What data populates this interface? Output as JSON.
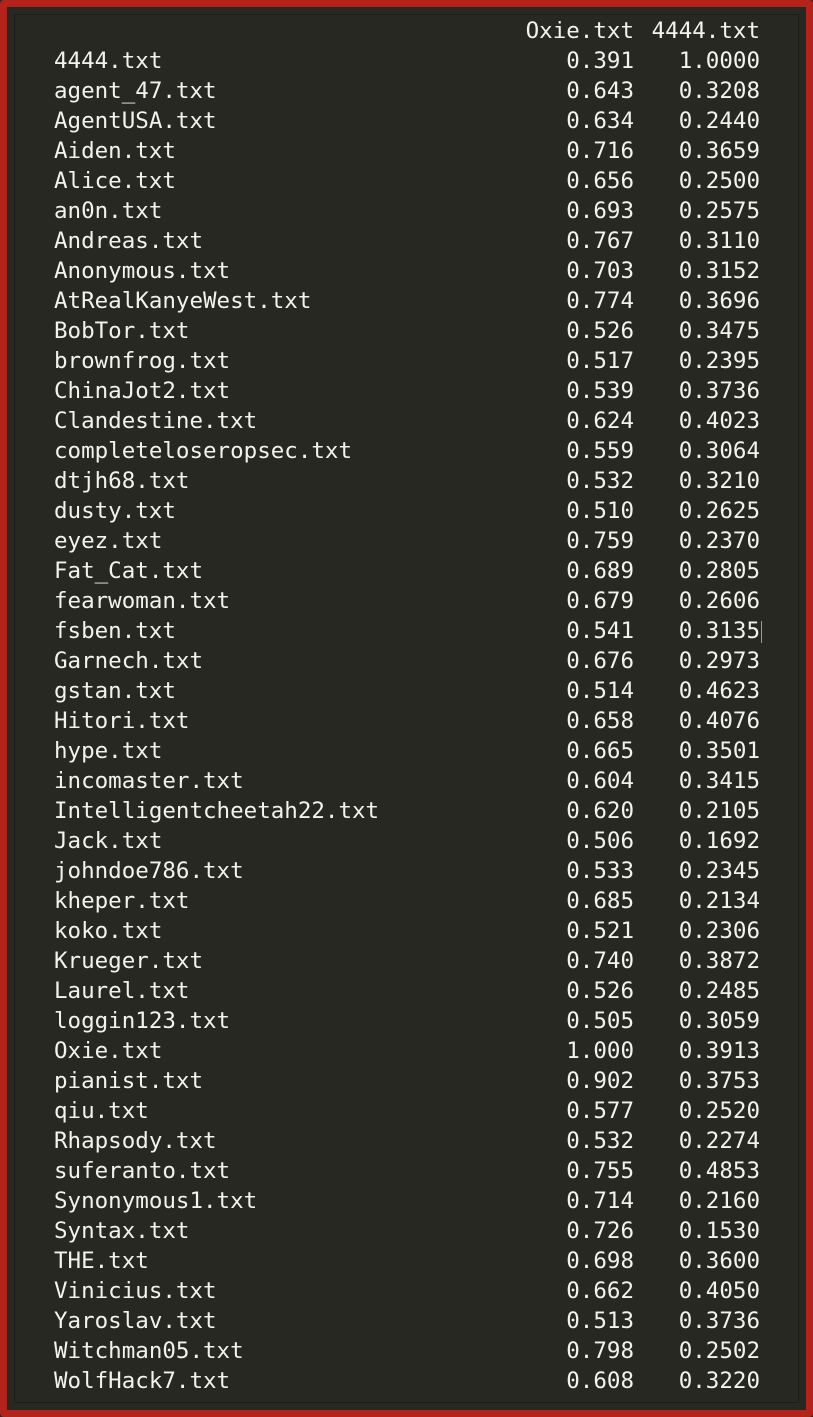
{
  "table": {
    "headers": [
      "Oxie.txt",
      "4444.txt"
    ],
    "rows": [
      {
        "name": "4444.txt",
        "oxie": "0.391",
        "v4444": "1.0000"
      },
      {
        "name": "agent_47.txt",
        "oxie": "0.643",
        "v4444": "0.3208"
      },
      {
        "name": "AgentUSA.txt",
        "oxie": "0.634",
        "v4444": "0.2440"
      },
      {
        "name": "Aiden.txt",
        "oxie": "0.716",
        "v4444": "0.3659"
      },
      {
        "name": "Alice.txt",
        "oxie": "0.656",
        "v4444": "0.2500"
      },
      {
        "name": "an0n.txt",
        "oxie": "0.693",
        "v4444": "0.2575"
      },
      {
        "name": "Andreas.txt",
        "oxie": "0.767",
        "v4444": "0.3110"
      },
      {
        "name": "Anonymous.txt",
        "oxie": "0.703",
        "v4444": "0.3152"
      },
      {
        "name": "AtRealKanyeWest.txt",
        "oxie": "0.774",
        "v4444": "0.3696"
      },
      {
        "name": "BobTor.txt",
        "oxie": "0.526",
        "v4444": "0.3475"
      },
      {
        "name": "brownfrog.txt",
        "oxie": "0.517",
        "v4444": "0.2395"
      },
      {
        "name": "ChinaJot2.txt",
        "oxie": "0.539",
        "v4444": "0.3736"
      },
      {
        "name": "Clandestine.txt",
        "oxie": "0.624",
        "v4444": "0.4023"
      },
      {
        "name": "completeloseropsec.txt",
        "oxie": "0.559",
        "v4444": "0.3064"
      },
      {
        "name": "dtjh68.txt",
        "oxie": "0.532",
        "v4444": "0.3210"
      },
      {
        "name": "dusty.txt",
        "oxie": "0.510",
        "v4444": "0.2625"
      },
      {
        "name": "eyez.txt",
        "oxie": "0.759",
        "v4444": "0.2370"
      },
      {
        "name": "Fat_Cat.txt",
        "oxie": "0.689",
        "v4444": "0.2805"
      },
      {
        "name": "fearwoman.txt",
        "oxie": "0.679",
        "v4444": "0.2606"
      },
      {
        "name": "fsben.txt",
        "oxie": "0.541",
        "v4444": "0.3135"
      },
      {
        "name": "Garnech.txt",
        "oxie": "0.676",
        "v4444": "0.2973"
      },
      {
        "name": "gstan.txt",
        "oxie": "0.514",
        "v4444": "0.4623"
      },
      {
        "name": "Hitori.txt",
        "oxie": "0.658",
        "v4444": "0.4076"
      },
      {
        "name": "hype.txt",
        "oxie": "0.665",
        "v4444": "0.3501"
      },
      {
        "name": "incomaster.txt",
        "oxie": "0.604",
        "v4444": "0.3415"
      },
      {
        "name": "Intelligentcheetah22.txt",
        "oxie": "0.620",
        "v4444": "0.2105"
      },
      {
        "name": "Jack.txt",
        "oxie": "0.506",
        "v4444": "0.1692"
      },
      {
        "name": "johndoe786.txt",
        "oxie": "0.533",
        "v4444": "0.2345"
      },
      {
        "name": "kheper.txt",
        "oxie": "0.685",
        "v4444": "0.2134"
      },
      {
        "name": "koko.txt",
        "oxie": "0.521",
        "v4444": "0.2306"
      },
      {
        "name": "Krueger.txt",
        "oxie": "0.740",
        "v4444": "0.3872"
      },
      {
        "name": "Laurel.txt",
        "oxie": "0.526",
        "v4444": "0.2485"
      },
      {
        "name": "loggin123.txt",
        "oxie": "0.505",
        "v4444": "0.3059"
      },
      {
        "name": "Oxie.txt",
        "oxie": "1.000",
        "v4444": "0.3913"
      },
      {
        "name": "pianist.txt",
        "oxie": "0.902",
        "v4444": "0.3753"
      },
      {
        "name": "qiu.txt",
        "oxie": "0.577",
        "v4444": "0.2520"
      },
      {
        "name": "Rhapsody.txt",
        "oxie": "0.532",
        "v4444": "0.2274"
      },
      {
        "name": "suferanto.txt",
        "oxie": "0.755",
        "v4444": "0.4853"
      },
      {
        "name": "Synonymous1.txt",
        "oxie": "0.714",
        "v4444": "0.2160"
      },
      {
        "name": "Syntax.txt",
        "oxie": "0.726",
        "v4444": "0.1530"
      },
      {
        "name": "THE.txt",
        "oxie": "0.698",
        "v4444": "0.3600"
      },
      {
        "name": "Vinicius.txt",
        "oxie": "0.662",
        "v4444": "0.4050"
      },
      {
        "name": "Yaroslav.txt",
        "oxie": "0.513",
        "v4444": "0.3736"
      },
      {
        "name": "Witchman05.txt",
        "oxie": "0.798",
        "v4444": "0.2502"
      },
      {
        "name": "WolfHack7.txt",
        "oxie": "0.608",
        "v4444": "0.3220"
      }
    ]
  },
  "colors": {
    "frame_border": "#b3231c",
    "background": "#272822",
    "text": "#f2f2ee"
  }
}
